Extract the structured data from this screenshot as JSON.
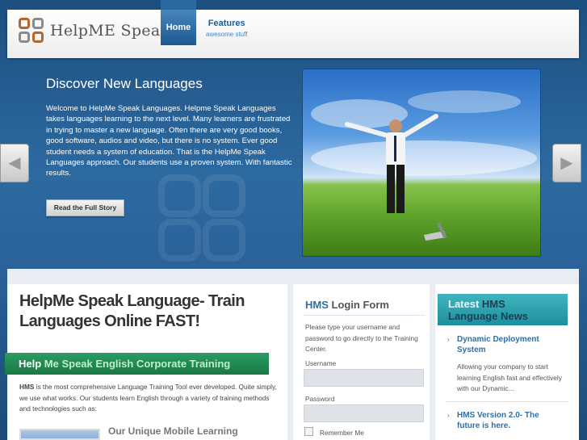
{
  "header": {
    "logo_text": "HelpME Speak",
    "nav": {
      "home_label": "Home",
      "features_label": "Features",
      "features_sub": "awesome stuff"
    }
  },
  "hero": {
    "title": "Discover New Languages",
    "text": "Welcome to HelpMe Speak Languages. Helpme Speak Languages takes languages learning to the next level.  Many learners are frustrated in trying to master a new language.  Often there are very good books, good software, audios and video, but there is no system.  Ever good student needs a system of education.  That is the HelpMe Speak Languages approach.  Our students use a proven system. With fantastic results.",
    "button_label": "Read the Full Story",
    "prev_icon": "chevron-left-icon",
    "next_icon": "chevron-right-icon"
  },
  "main": {
    "title": "HelpMe Speak Language- Train Languages Online FAST!",
    "banner_part1": "Help",
    "banner_part2": " Me Speak English Corporate Training",
    "body_bold": "HMS",
    "body_text": " is the most comprehensive Language Training Tool ever developed.  Quite simply, we use what works.  Our students learn English through a variety of training methods and technologies such as:",
    "mobile_title": "Our Unique Mobile Learning"
  },
  "login": {
    "title_bold": "HMS",
    "title_rest": " Login Form",
    "description": "Please type your username and password to go directly to the Training Center.",
    "username_label": "Username",
    "username_value": "",
    "password_label": "Password",
    "password_value": "",
    "remember_label": "Remember Me"
  },
  "news": {
    "header_latest": "Latest",
    "header_hms": " HMS",
    "header_line2": "Language News",
    "items": [
      {
        "title": "Dynamic Deployment System",
        "text": "Allowing your company to start learning English fast and effectively with our Dynamic..."
      },
      {
        "title": "HMS Version 2.0- The future is here."
      }
    ]
  },
  "colors": {
    "accent_blue": "#2f6fa6",
    "banner_green": "#1f8a52",
    "news_teal": "#2aa3ae"
  }
}
